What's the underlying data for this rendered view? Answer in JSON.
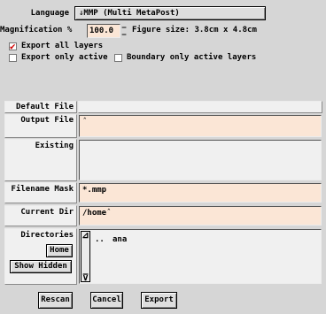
{
  "language": {
    "label": "Language",
    "value": "MMP (Multi MetaPost)",
    "icon": "chevron-down-icon"
  },
  "magnification": {
    "label": "Magnification %",
    "value": "100.0",
    "figure_size": "Figure size: 3.8cm x 4.8cm"
  },
  "export_options": {
    "export_all": {
      "label": "Export all layers",
      "checked": true
    },
    "export_active": {
      "label": "Export only active",
      "checked": false
    },
    "boundary_active": {
      "label": "Boundary only active layers",
      "checked": false
    }
  },
  "files": {
    "default_file_label": "Default File",
    "output_file_label": "Output File",
    "output_file_value": "",
    "existing_label": "Existing",
    "filename_mask_label": "Filename Mask",
    "filename_mask_value": "*.mmp",
    "current_dir_label": "Current Dir",
    "current_dir_value": "/home",
    "directories_label": "Directories",
    "home_button": "Home",
    "show_hidden_button": "Show Hidden",
    "directory_entries": [
      "..",
      "ana"
    ]
  },
  "actions": {
    "rescan": "Rescan",
    "cancel": "Cancel",
    "export": "Export"
  },
  "colors": {
    "field_bg": "#fbe6d6",
    "panel_bg": "#d6d6d6",
    "checkmark": "#d00000"
  }
}
